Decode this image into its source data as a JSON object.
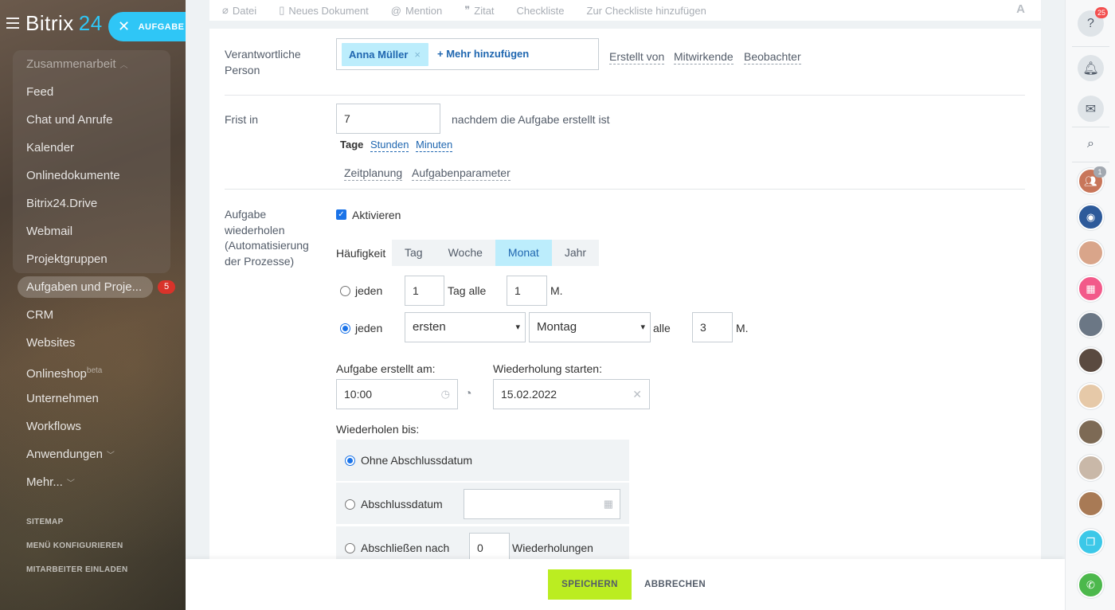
{
  "app": {
    "logo_text": "Bitrix",
    "logo_num": "24",
    "new_task_label": "AUFGABE"
  },
  "sidebar": {
    "items": [
      {
        "label": "Zusammenarbeit",
        "group": true
      },
      {
        "label": "Feed"
      },
      {
        "label": "Chat und Anrufe"
      },
      {
        "label": "Kalender"
      },
      {
        "label": "Onlinedokumente"
      },
      {
        "label": "Bitrix24.Drive"
      },
      {
        "label": "Webmail"
      },
      {
        "label": "Projektgruppen"
      },
      {
        "label": "Aufgaben und Proje...",
        "active": true,
        "counter": "5"
      },
      {
        "label": "CRM"
      },
      {
        "label": "Websites"
      },
      {
        "label": "Onlineshop",
        "sup": "beta"
      },
      {
        "label": "Unternehmen"
      },
      {
        "label": "Workflows"
      },
      {
        "label": "Anwendungen"
      },
      {
        "label": "Mehr..."
      }
    ],
    "links": [
      "SITEMAP",
      "MENÜ KONFIGURIEREN",
      "MITARBEITER EINLADEN"
    ]
  },
  "toolbar": {
    "items": [
      "Datei",
      "Neues Dokument",
      "Mention",
      "Zitat",
      "Checkliste",
      "Zur Checkliste hinzufügen"
    ],
    "format_label": "A"
  },
  "form": {
    "responsible": {
      "label": "Verantwortliche Person",
      "user": "Anna Müller",
      "remove": "×",
      "add_more": "+ Mehr hinzufügen",
      "links": [
        "Erstellt von",
        "Mitwirkende",
        "Beobachter"
      ]
    },
    "deadline": {
      "label": "Frist in",
      "value": "7",
      "suffix": "nachdem die Aufgabe erstellt ist",
      "units": [
        "Tage",
        "Stunden",
        "Minuten"
      ],
      "sub_links": [
        "Zeitplanung",
        "Aufgabenparameter"
      ]
    },
    "repeat": {
      "label": "Aufgabe wiederholen (Automatisierung der Prozesse)",
      "activate": "Aktivieren",
      "frequency_label": "Häufigkeit",
      "frequency": [
        "Tag",
        "Woche",
        "Monat",
        "Jahr"
      ],
      "frequency_selected": "Monat",
      "opt1": {
        "prefix": "jeden",
        "day": "1",
        "mid": "Tag alle",
        "months": "1",
        "suffix": "M."
      },
      "opt2": {
        "prefix": "jeden",
        "ordinal": "ersten",
        "weekday": "Montag",
        "mid": "alle",
        "months": "3",
        "suffix": "M."
      },
      "created_at_label": "Aufgabe erstellt am:",
      "created_at_value": "10:00",
      "start_label": "Wiederholung starten:",
      "start_value": "15.02.2022",
      "until_label": "Wiederholen bis:",
      "until_options": {
        "no_end": "Ohne Abschlussdatum",
        "end_date": "Abschlussdatum",
        "end_after": "Abschließen nach",
        "end_after_value": "0",
        "end_after_suffix": "Wiederholungen"
      }
    }
  },
  "footer": {
    "save": "SPEICHERN",
    "cancel": "ABBRECHEN"
  },
  "rightbar": {
    "help_badge": "25",
    "contacts_badge": "1"
  }
}
